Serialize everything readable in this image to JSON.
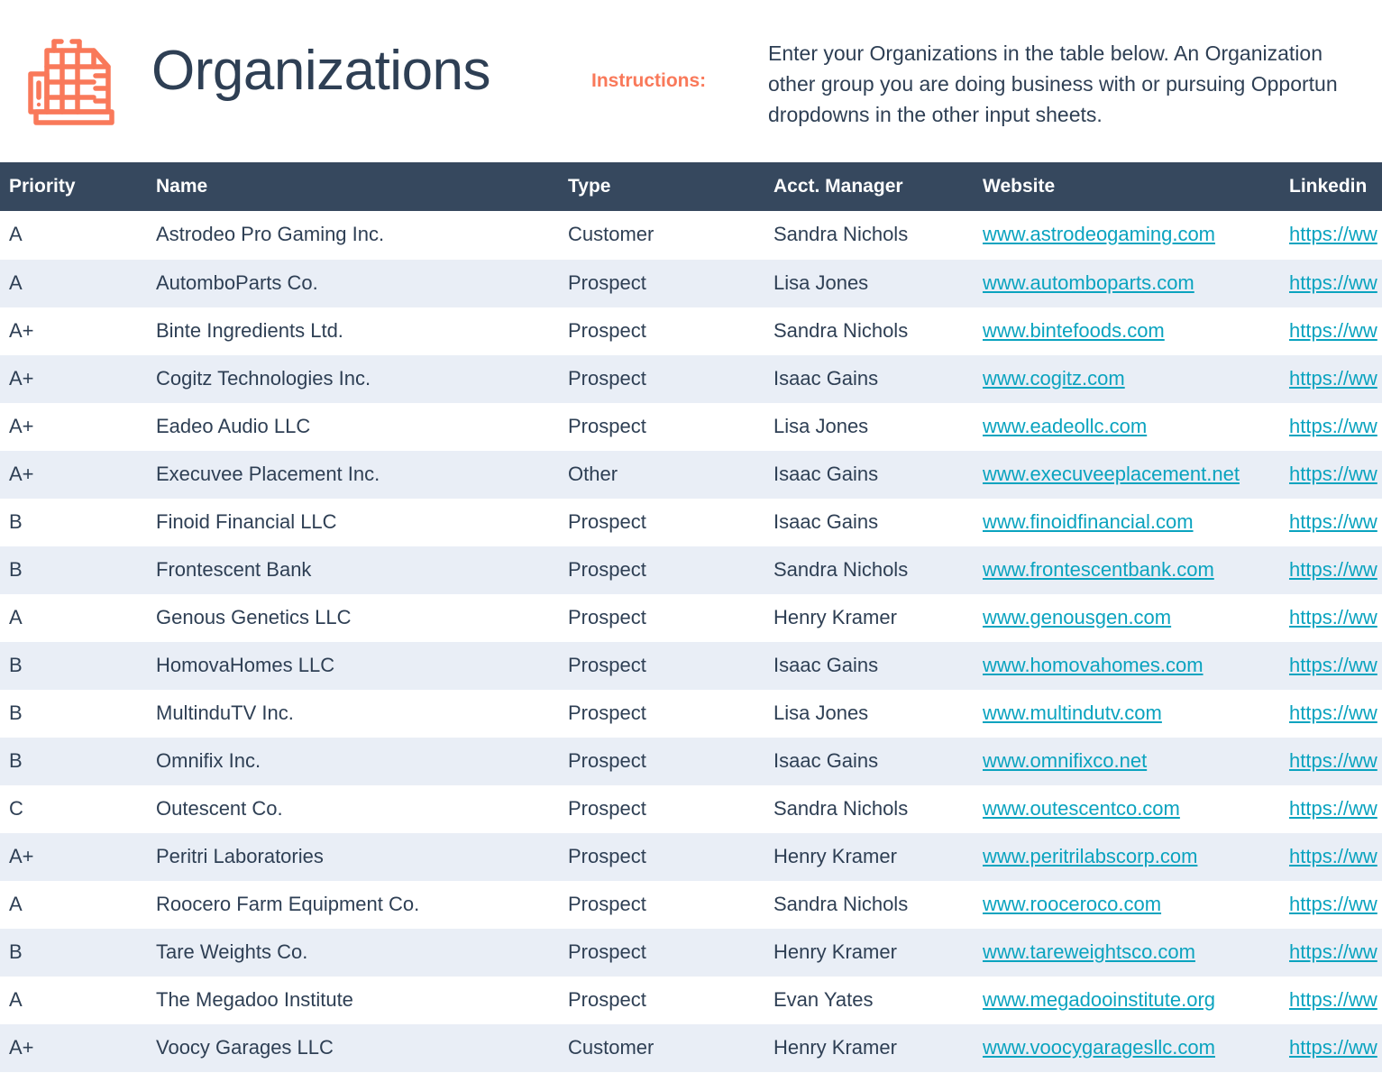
{
  "header": {
    "title": "Organizations",
    "icon": "office-building-icon",
    "instructions_label": "Instructions:",
    "instructions_lines": [
      "Enter your Organizations in the table below. An Organization",
      "other group you are doing business with or pursuing Opportun",
      "dropdowns in the other input sheets."
    ]
  },
  "colors": {
    "accent_orange": "#f9795a",
    "header_navy": "#36485e",
    "text_navy": "#2e3f54",
    "link_teal": "#0aa3bf",
    "row_alt": "#e9eef6"
  },
  "table": {
    "columns": [
      "Priority",
      "Name",
      "Type",
      "Acct. Manager",
      "Website",
      "Linkedin"
    ],
    "rows": [
      {
        "priority": "A",
        "name": "Astrodeo Pro Gaming Inc.",
        "type": "Customer",
        "acct_manager": "Sandra Nichols",
        "website": "www.astrodeogaming.com",
        "linkedin": "https://ww"
      },
      {
        "priority": "A",
        "name": "AutomboParts Co.",
        "type": "Prospect",
        "acct_manager": "Lisa Jones",
        "website": "www.automboparts.com",
        "linkedin": "https://ww"
      },
      {
        "priority": "A+",
        "name": "Binte Ingredients Ltd.",
        "type": "Prospect",
        "acct_manager": "Sandra Nichols",
        "website": "www.bintefoods.com",
        "linkedin": "https://ww"
      },
      {
        "priority": "A+",
        "name": "Cogitz Technologies Inc.",
        "type": "Prospect",
        "acct_manager": "Isaac Gains",
        "website": "www.cogitz.com",
        "linkedin": "https://ww"
      },
      {
        "priority": "A+",
        "name": "Eadeo Audio LLC",
        "type": "Prospect",
        "acct_manager": "Lisa Jones",
        "website": "www.eadeollc.com",
        "linkedin": "https://ww"
      },
      {
        "priority": "A+",
        "name": "Execuvee Placement Inc.",
        "type": "Other",
        "acct_manager": "Isaac Gains",
        "website": "www.execuveeplacement.net",
        "linkedin": "https://ww"
      },
      {
        "priority": "B",
        "name": "Finoid Financial LLC",
        "type": "Prospect",
        "acct_manager": "Isaac Gains",
        "website": "www.finoidfinancial.com",
        "linkedin": "https://ww"
      },
      {
        "priority": "B",
        "name": "Frontescent Bank",
        "type": "Prospect",
        "acct_manager": "Sandra Nichols",
        "website": "www.frontescentbank.com",
        "linkedin": "https://ww"
      },
      {
        "priority": "A",
        "name": "Genous Genetics LLC",
        "type": "Prospect",
        "acct_manager": "Henry Kramer",
        "website": "www.genousgen.com",
        "linkedin": "https://ww"
      },
      {
        "priority": "B",
        "name": "HomovaHomes LLC",
        "type": "Prospect",
        "acct_manager": "Isaac Gains",
        "website": "www.homovahomes.com",
        "linkedin": "https://ww"
      },
      {
        "priority": "B",
        "name": "MultinduTV Inc.",
        "type": "Prospect",
        "acct_manager": "Lisa Jones",
        "website": "www.multindutv.com",
        "linkedin": "https://ww"
      },
      {
        "priority": "B",
        "name": "Omnifix Inc.",
        "type": "Prospect",
        "acct_manager": "Isaac Gains",
        "website": "www.omnifixco.net",
        "linkedin": "https://ww"
      },
      {
        "priority": "C",
        "name": "Outescent Co.",
        "type": "Prospect",
        "acct_manager": "Sandra Nichols",
        "website": "www.outescentco.com",
        "linkedin": "https://ww"
      },
      {
        "priority": "A+",
        "name": "Peritri Laboratories",
        "type": "Prospect",
        "acct_manager": "Henry Kramer",
        "website": "www.peritrilabscorp.com",
        "linkedin": "https://ww"
      },
      {
        "priority": "A",
        "name": "Roocero Farm Equipment Co.",
        "type": "Prospect",
        "acct_manager": "Sandra Nichols",
        "website": "www.rooceroco.com",
        "linkedin": "https://ww"
      },
      {
        "priority": "B",
        "name": "Tare Weights Co.",
        "type": "Prospect",
        "acct_manager": "Henry Kramer",
        "website": "www.tareweightsco.com",
        "linkedin": "https://ww"
      },
      {
        "priority": "A",
        "name": "The Megadoo Institute",
        "type": "Prospect",
        "acct_manager": "Evan Yates",
        "website": "www.megadooinstitute.org",
        "linkedin": "https://ww"
      },
      {
        "priority": "A+",
        "name": "Voocy Garages LLC",
        "type": "Customer",
        "acct_manager": "Henry Kramer",
        "website": "www.voocygaragesllc.com",
        "linkedin": "https://ww"
      }
    ]
  }
}
